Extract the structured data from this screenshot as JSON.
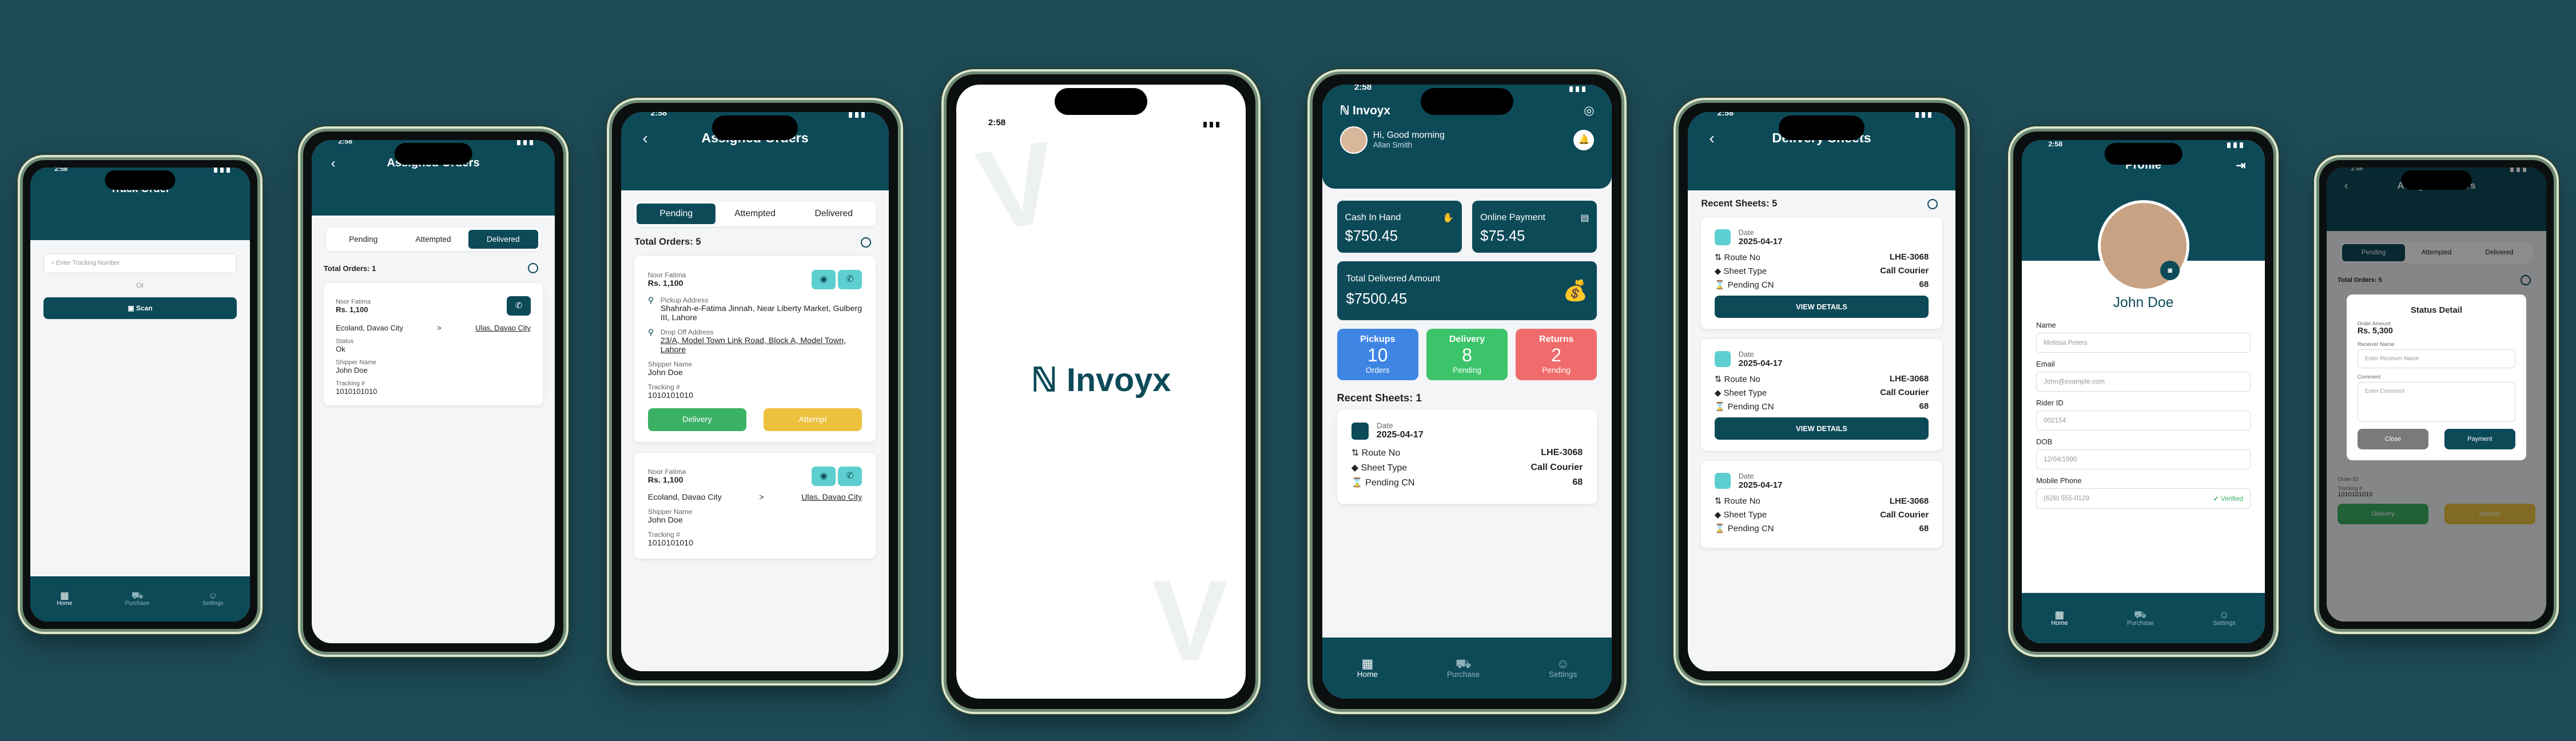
{
  "time": "2:58",
  "track": {
    "title": "Track Order",
    "placeholder": "Enter Tracking Number",
    "or": "Or",
    "scan": "Scan"
  },
  "nav": {
    "home": "Home",
    "purchase": "Purchase",
    "settings": "Settings"
  },
  "assigned1": {
    "title": "Assigned Orders",
    "tabs": [
      "Pending",
      "Attempted",
      "Delivered"
    ],
    "total": "Total Orders: 1",
    "name": "Noor Fatima",
    "amount": "Rs. 1,100",
    "from": "Ecoland, Davao City",
    "arrow": ">",
    "to": "Ulas, Davao City",
    "status_label": "Status",
    "status": "Ok",
    "shipper_label": "Shipper Name",
    "shipper": "John Doe",
    "tracking_label": "Tracking #",
    "tracking": "1010101010"
  },
  "assigned2": {
    "title": "Assigned Orders",
    "tabs": [
      "Pending",
      "Attempted",
      "Delivered"
    ],
    "total": "Total Orders: 5",
    "name": "Noor Fatima",
    "amount": "Rs. 1,100",
    "pickup_label": "Pickup Address",
    "pickup": "Shahrah-e-Fatima Jinnah, Near Liberty Market, Gulberg III, Lahore",
    "drop_label": "Drop Off Address",
    "drop": "23/A, Model Town Link Road, Block A, Model Town, Lahore",
    "shipper_label": "Shipper Name",
    "shipper": "John Doe",
    "tracking_label": "Tracking #",
    "tracking": "1010101010",
    "delivery": "Delivery",
    "attempt": "Attempt",
    "name2": "Noor Fatima",
    "amount2": "Rs. 1,100",
    "from": "Ecoland, Davao City",
    "arrow": ">",
    "to": "Ulas, Davao City",
    "shipper2": "John Doe",
    "tracking2": "1010101010"
  },
  "splash": {
    "brand": "Invoyx"
  },
  "home": {
    "brand": "Invoyx",
    "greeting": "Hi, Good morning",
    "user": "Allan Smith",
    "cash_label": "Cash In Hand",
    "cash": "$750.45",
    "online_label": "Online Payment",
    "online": "$75.45",
    "delivered_label": "Total Delivered Amount",
    "delivered": "$7500.45",
    "pickups_label": "Pickups",
    "pickups": "10",
    "pickups_sub": "Orders",
    "delivery_label": "Delivery",
    "delivery": "8",
    "delivery_sub": "Pending",
    "returns_label": "Returns",
    "returns": "2",
    "returns_sub": "Pending",
    "recent": "Recent Sheets: 1",
    "date_label": "Date",
    "date": "2025-04-17",
    "route_label": "Route No",
    "route": "LHE-3068",
    "sheet_label": "Sheet Type",
    "sheet": "Call Courier",
    "pending_label": "Pending CN",
    "pending": "68"
  },
  "sheets": {
    "title": "Delivery Sheets",
    "recent": "Recent Sheets: 5",
    "date_label": "Date",
    "date": "2025-04-17",
    "route_label": "Route No",
    "route": "LHE-3068",
    "sheet_label": "Sheet Type",
    "sheet": "Call Courier",
    "pending_label": "Pending CN",
    "pending": "68",
    "view": "VIEW DETAILS"
  },
  "profile": {
    "title": "Profile",
    "name": "John Doe",
    "name_label": "Name",
    "name_val": "Melissa Peters",
    "email_label": "Email",
    "email": "John@example.com",
    "rider_label": "Rider ID",
    "rider": "002154",
    "dob_label": "DOB",
    "dob": "12/04/1990",
    "mobile_label": "Mobile Phone",
    "mobile": "(628) 555-0129",
    "verified": "Verified"
  },
  "status": {
    "title": "Assigned Orders",
    "tabs": [
      "Pending",
      "Attempted",
      "Delivered"
    ],
    "total": "Total Orders: 5",
    "dialog_title": "Status Detail",
    "amount_label": "Order Amount",
    "amount": "Rs. 5,300",
    "receiver_label": "Receiver Name",
    "receiver_ph": "Enter Receiver Name",
    "comment_label": "Comment",
    "comment_ph": "Enter Comment",
    "close": "Close",
    "payment": "Payment",
    "order_label": "Order ID",
    "tracking_label": "Tracking #",
    "tracking": "1010101010",
    "delivery": "Delivery",
    "attempt": "Attempt"
  },
  "colors": {
    "primary": "#0d4a58",
    "accent": "#5ecfd0",
    "bg": "#1d4a56"
  }
}
